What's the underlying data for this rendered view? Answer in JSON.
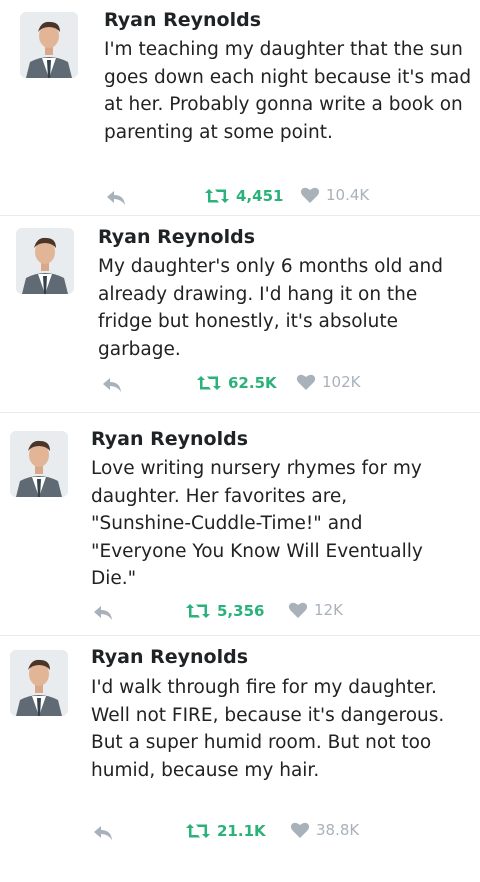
{
  "colors": {
    "retweet": "#2bb17a",
    "like": "#a9b2ba",
    "reply": "#a9b2ba",
    "text": "#222222"
  },
  "tweets": [
    {
      "author": "Ryan Reynolds",
      "text": "I'm teaching my daughter that the sun goes down each night because it's mad at her. Probably gonna write a book on parenting at some point.",
      "retweets": "4,451",
      "likes": "10.4K",
      "icons": [
        "reply-icon",
        "retweet-icon",
        "heart-icon"
      ]
    },
    {
      "author": "Ryan Reynolds",
      "text": "My daughter's only 6 months old and already drawing. I'd hang it on the fridge but honestly, it's absolute garbage.",
      "retweets": "62.5K",
      "likes": "102K",
      "icons": [
        "reply-icon",
        "retweet-icon",
        "heart-icon"
      ]
    },
    {
      "author": "Ryan Reynolds",
      "text": "Love writing nursery rhymes for my daughter. Her favorites are, \"Sunshine-Cuddle-Time!\" and \"Everyone You Know Will Eventually Die.\"",
      "retweets": "5,356",
      "likes": "12K",
      "icons": [
        "reply-icon",
        "retweet-icon",
        "heart-icon"
      ]
    },
    {
      "author": "Ryan Reynolds",
      "text": "I'd walk through fire for my daughter. Well not FIRE, because it's dangerous. But a super humid room. But not too humid, because my hair.",
      "retweets": "21.1K",
      "likes": "38.8K",
      "icons": [
        "reply-icon",
        "retweet-icon",
        "heart-icon"
      ]
    }
  ]
}
